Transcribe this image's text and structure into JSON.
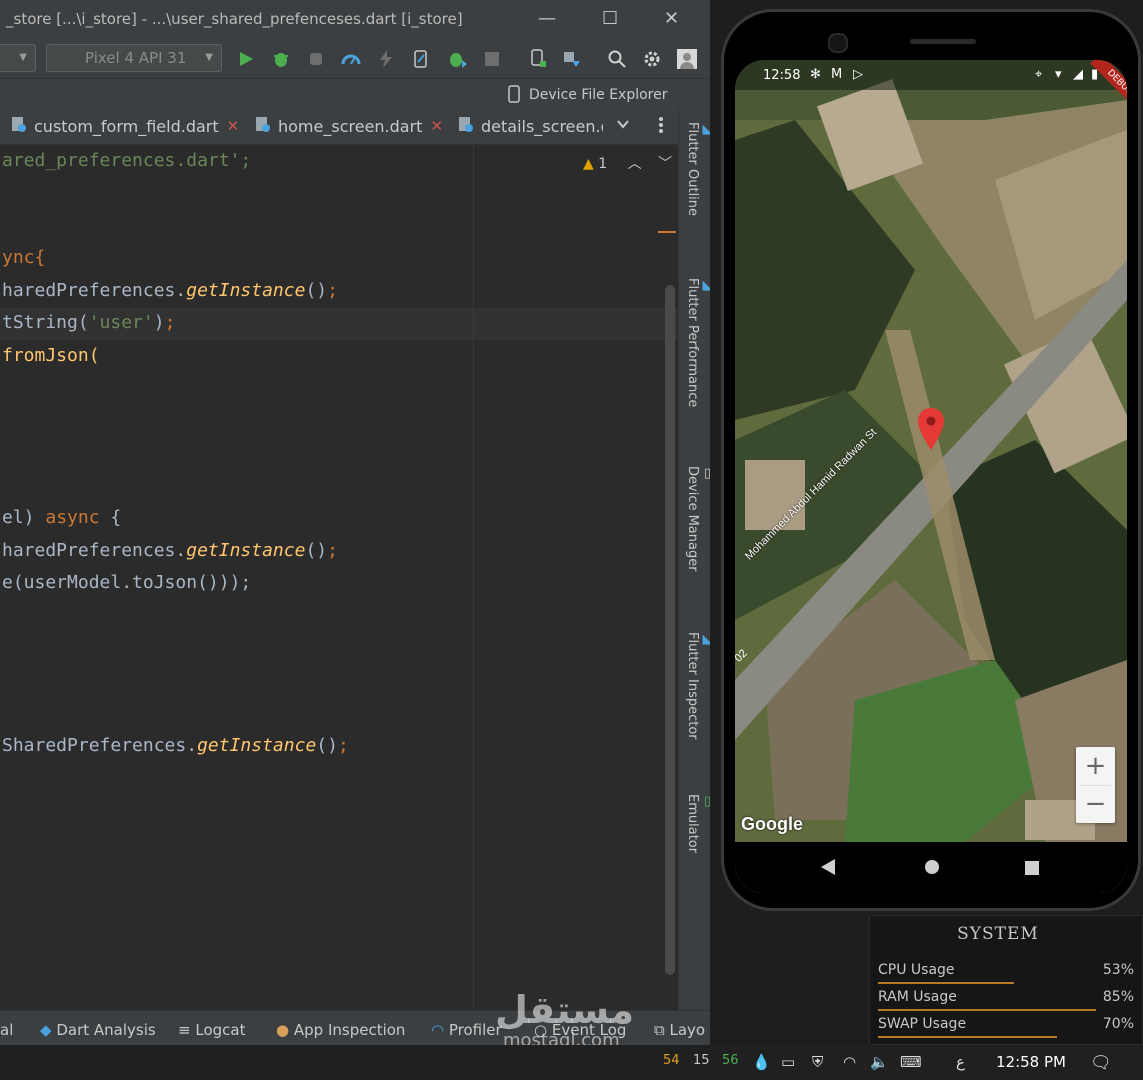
{
  "window": {
    "title": "_store [...\\i_store] - ...\\user_shared_prefenceses.dart [i_store]",
    "minimize": "—",
    "maximize": "☐",
    "close": "✕"
  },
  "toolbar": {
    "config_dropdown": "",
    "device_dropdown": "Pixel 4 API 31"
  },
  "device_file_explorer": "Device File Explorer",
  "tabs": [
    {
      "label": "custom_form_field.dart",
      "close": "✕"
    },
    {
      "label": "home_screen.dart",
      "close": "✕"
    },
    {
      "label": "details_screen.d"
    }
  ],
  "editor": {
    "warning_count": "1",
    "lines": [
      {
        "text": "ared_preferences.dart';"
      },
      {
        "text": "ync{"
      },
      {
        "text": "haredPreferences.getInstance();"
      },
      {
        "text": "tString('user');"
      },
      {
        "text": "fromJson("
      },
      {
        "text": "el) async {"
      },
      {
        "text": "haredPreferences.getInstance();"
      },
      {
        "text": "e(userModel.toJson()));"
      },
      {
        "text": "SharedPreferences.getInstance();"
      }
    ]
  },
  "right_sidebar": [
    "Flutter Outline",
    "Flutter Performance",
    "Device Manager",
    "Flutter Inspector",
    "Emulator"
  ],
  "bottom_tools": [
    "al",
    "Dart Analysis",
    "Logcat",
    "App Inspection",
    "Profiler",
    "Event Log",
    "Layo"
  ],
  "phone": {
    "time": "12:58",
    "debug_ribbon": "DEBUG",
    "road_label": "Mohammed Abdul Hamid Radwan St",
    "road_number": "02",
    "google_logo": "Google",
    "zoom_in": "+",
    "zoom_out": "−"
  },
  "system_widget": {
    "title": "SYSTEM",
    "rows": [
      {
        "label": "CPU Usage",
        "value": "53%",
        "level": 0.53
      },
      {
        "label": "RAM Usage",
        "value": "85%",
        "level": 0.85
      },
      {
        "label": "SWAP Usage",
        "value": "70%",
        "level": 0.7
      }
    ]
  },
  "watermark": {
    "arabic": "مستقل",
    "latin": "mostaql.com"
  },
  "taskbar": {
    "counter_orange": "54",
    "counter_gray": "15",
    "counter_green": "56",
    "language": "ع",
    "time": "12:58 PM"
  },
  "colors": {
    "ide_bg": "#2b2b2b",
    "panel_bg": "#3c3f41",
    "string_green": "#6a8759",
    "keyword_orange": "#cc7832",
    "method_yellow": "#ffc66d",
    "accent_bar": "#b57b2a",
    "marker_red": "#e53935"
  }
}
